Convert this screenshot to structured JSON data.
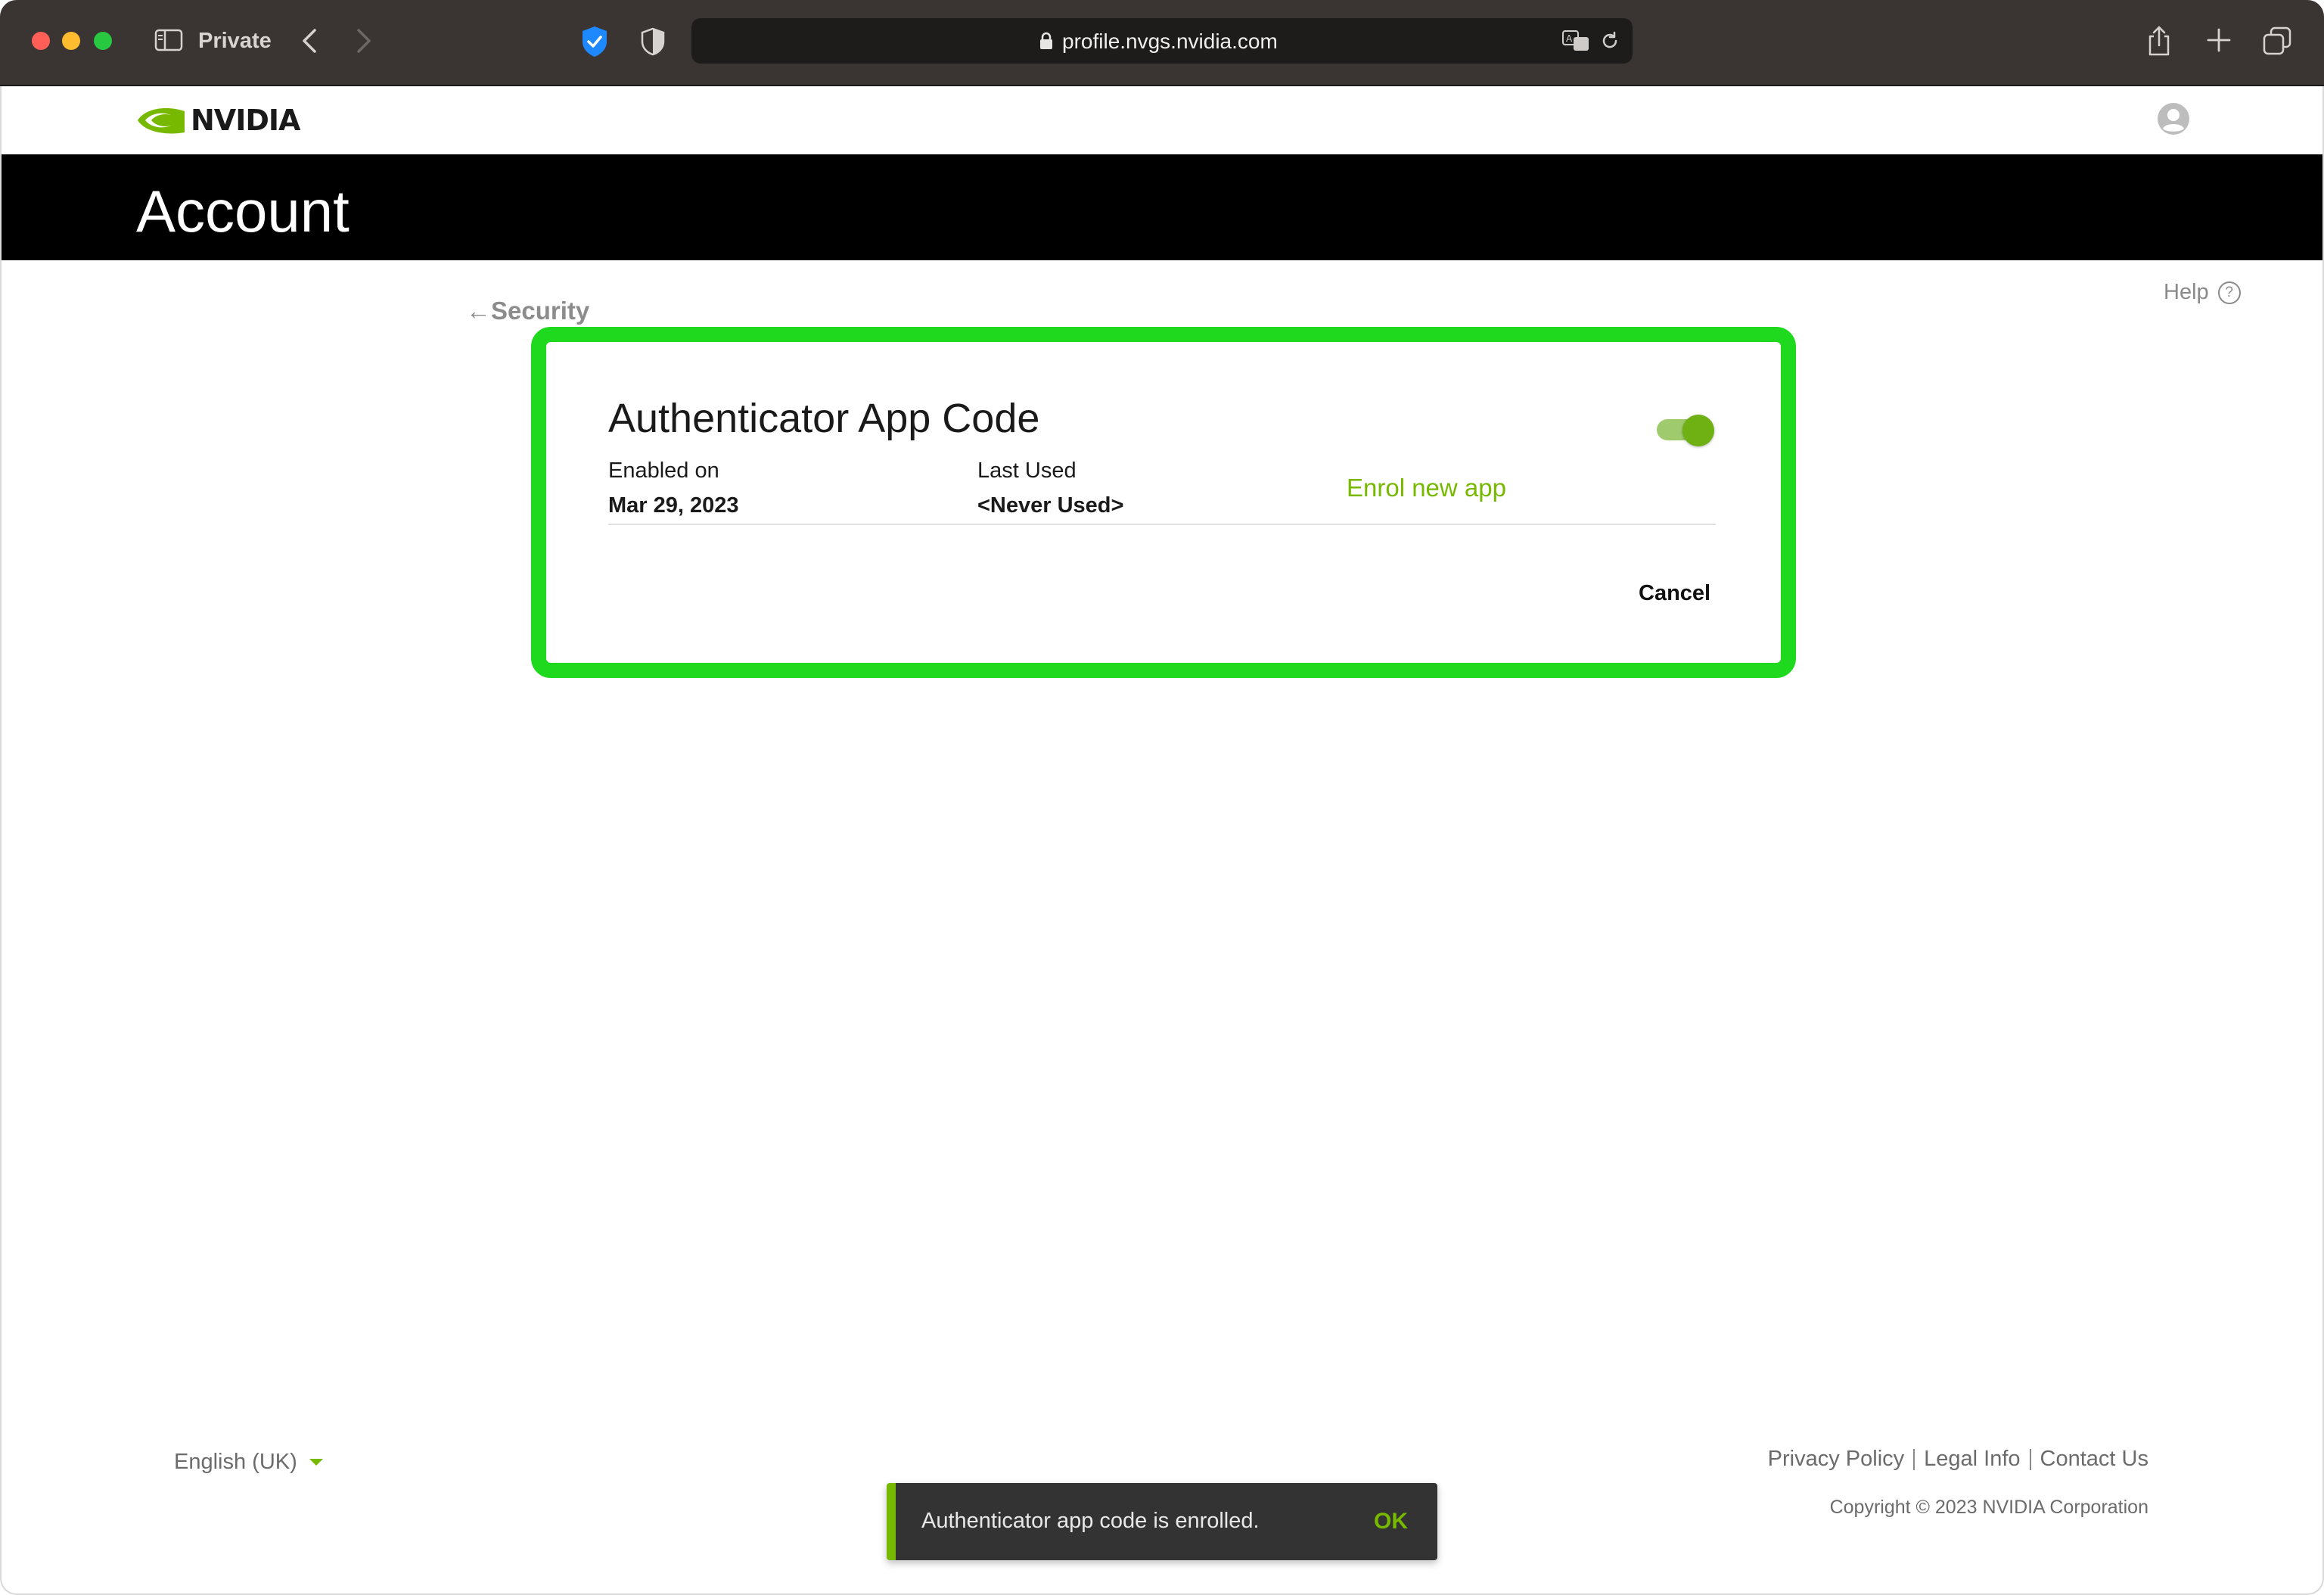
{
  "browser": {
    "private_label": "Private",
    "url": "profile.nvgs.nvidia.com"
  },
  "site": {
    "logo_text": "NVIDIA",
    "page_title": "Account",
    "help_label": "Help",
    "help_icon_glyph": "?",
    "back_link": "←Security"
  },
  "authenticator": {
    "title": "Authenticator App Code",
    "enabled_label": "Enabled on",
    "enabled_value": "Mar 29, 2023",
    "last_used_label": "Last Used",
    "last_used_value": "<Never Used>",
    "enrol_link": "Enrol new app",
    "cancel_label": "Cancel",
    "toggle_on": true,
    "highlight_color": "#1ed91e"
  },
  "footer": {
    "language": "English (UK)",
    "links": [
      "Privacy Policy",
      "Legal Info",
      "Contact Us"
    ],
    "copyright": "Copyright © 2023 NVIDIA Corporation"
  },
  "toast": {
    "message": "Authenticator app code is enrolled.",
    "ok_label": "OK"
  },
  "colors": {
    "brand_green": "#76b900",
    "banner_bg": "#000000",
    "toolbar_bg": "#3a3533"
  }
}
